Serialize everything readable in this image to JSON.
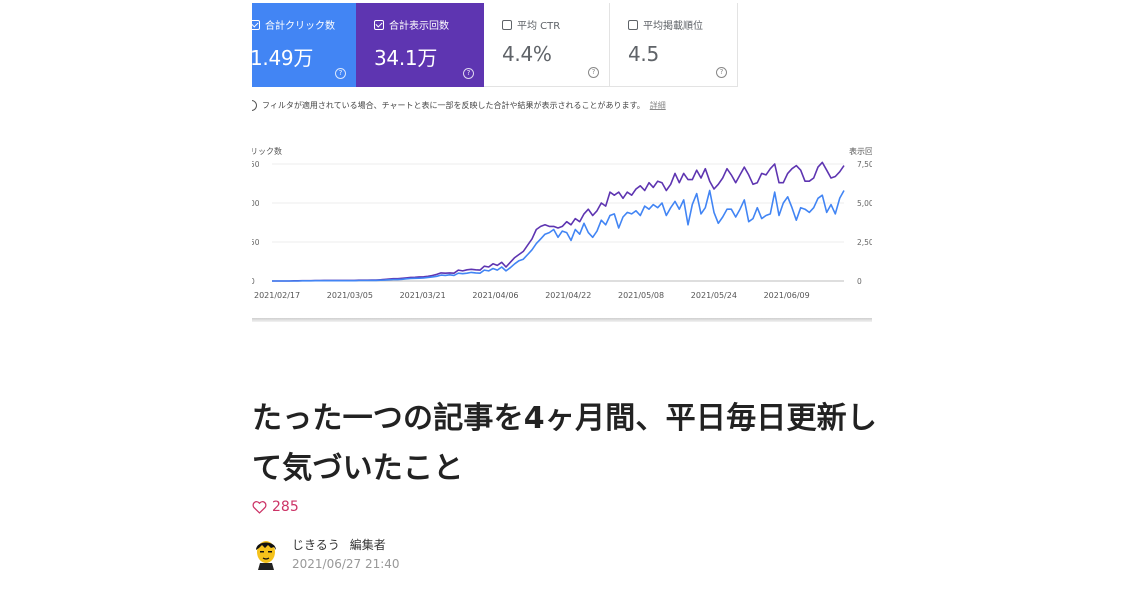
{
  "screenshot": {
    "cards": [
      {
        "label": "合計クリック数",
        "value": "1.49万",
        "checked": true,
        "color": "#4285f4"
      },
      {
        "label": "合計表示回数",
        "value": "34.1万",
        "checked": true,
        "color": "#5e35b1"
      },
      {
        "label": "平均 CTR",
        "value": "4.4%",
        "checked": false
      },
      {
        "label": "平均掲載順位",
        "value": "4.5",
        "checked": false
      }
    ],
    "help_glyph": "?",
    "info_glyph": "i",
    "notice": "フィルタが適用されている場合、チャートと表に一部を反映した合計や結果が表示されることがあります。",
    "notice_link": "詳細"
  },
  "chart_data": {
    "type": "line",
    "left_axis_label": "リック数",
    "right_axis_label": "表示回",
    "left_ticks": [
      "50",
      "00",
      "50",
      "0"
    ],
    "left_ylim": [
      0,
      150
    ],
    "right_ticks": [
      "7,50",
      "5,00",
      "2,50",
      "0"
    ],
    "right_ylim": [
      0,
      7500
    ],
    "x_ticks": [
      "2021/02/17",
      "2021/03/05",
      "2021/03/21",
      "2021/04/06",
      "2021/04/22",
      "2021/05/08",
      "2021/05/24",
      "2021/06/09"
    ],
    "grid": true,
    "series": [
      {
        "axis": "right",
        "color": "#5e35b1",
        "values": [
          0,
          0,
          0,
          0,
          0,
          10,
          10,
          20,
          20,
          20,
          30,
          30,
          40,
          40,
          40,
          40,
          40,
          40,
          40,
          40,
          50,
          50,
          50,
          60,
          60,
          80,
          100,
          130,
          150,
          150,
          170,
          200,
          230,
          240,
          260,
          270,
          300,
          350,
          420,
          520,
          500,
          520,
          500,
          700,
          650,
          720,
          750,
          720,
          700,
          950,
          900,
          1100,
          1000,
          1200,
          900,
          1200,
          1500,
          1700,
          1900,
          2300,
          2700,
          3300,
          3500,
          3600,
          3500,
          3500,
          3400,
          3500,
          3800,
          3600,
          4000,
          3800,
          4300,
          4600,
          4200,
          4500,
          5000,
          4800,
          5700,
          5500,
          5700,
          5300,
          5700,
          5500,
          5900,
          6100,
          5800,
          6300,
          6000,
          6400,
          6300,
          5800,
          6200,
          6900,
          6300,
          6900,
          6500,
          6500,
          7100,
          6600,
          7200,
          6400,
          5900,
          6200,
          6600,
          7200,
          6800,
          6300,
          6800,
          7300,
          6800,
          6200,
          6300,
          6900,
          6800,
          7200,
          7500,
          6300,
          6300,
          6900,
          7200,
          7400,
          7100,
          6400,
          6400,
          6600,
          7300,
          7600,
          7100,
          6600,
          6700,
          7000,
          7400
        ]
      },
      {
        "axis": "right",
        "color": "#4285f4",
        "values": [
          0,
          0,
          0,
          0,
          0,
          0,
          0,
          10,
          10,
          10,
          20,
          20,
          20,
          20,
          20,
          20,
          20,
          20,
          20,
          20,
          30,
          30,
          30,
          40,
          40,
          50,
          60,
          80,
          90,
          90,
          110,
          140,
          160,
          170,
          180,
          200,
          230,
          260,
          300,
          380,
          360,
          400,
          360,
          500,
          470,
          500,
          550,
          520,
          500,
          700,
          650,
          800,
          700,
          900,
          650,
          850,
          1100,
          1300,
          1400,
          1700,
          2000,
          2400,
          2700,
          3000,
          3100,
          3300,
          2800,
          3200,
          3100,
          2600,
          3300,
          3000,
          3700,
          3100,
          2800,
          3200,
          3900,
          3600,
          4200,
          4300,
          3400,
          4100,
          4400,
          4300,
          4500,
          4200,
          4800,
          4600,
          4900,
          4700,
          5000,
          4200,
          4700,
          5100,
          4600,
          5200,
          3600,
          4900,
          5600,
          4300,
          4700,
          5800,
          4400,
          3700,
          4100,
          4600,
          4600,
          4100,
          4600,
          5200,
          3800,
          4000,
          4700,
          4000,
          4200,
          4300,
          5700,
          4200,
          5000,
          5400,
          4700,
          3900,
          4700,
          4600,
          4400,
          4700,
          5300,
          5500,
          4400,
          4900,
          4300,
          5300,
          5800
        ]
      }
    ]
  },
  "article": {
    "title": "たった一つの記事を4ヶ月間、平日毎日更新して気づいたこと",
    "likes": "285",
    "author_name": "じきるう",
    "author_role": "編集者",
    "date": "2021/06/27 21:40"
  }
}
